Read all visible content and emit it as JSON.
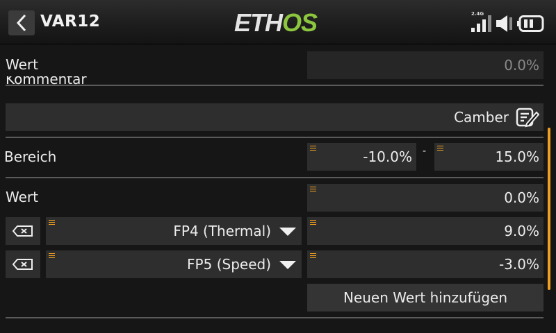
{
  "header": {
    "title": "VAR12",
    "logo_part1": "ETH",
    "logo_part2": "OS",
    "rf_label": "2.4G"
  },
  "value_row": {
    "label": "Wert",
    "value": "0.0%"
  },
  "comment_row": {
    "label": "Kommentar",
    "value": "Camber"
  },
  "range_row": {
    "label": "Bereich",
    "min": "-10.0%",
    "separator": "-",
    "max": "15.0%"
  },
  "values_section": {
    "label": "Wert",
    "default_value": "0.0%",
    "entries": [
      {
        "flight_mode": "FP4 (Thermal)",
        "value": "9.0%"
      },
      {
        "flight_mode": "FP5 (Speed)",
        "value": "-3.0%"
      }
    ],
    "add_button": "Neuen Wert hinzufügen"
  },
  "colors": {
    "accent": "#f0a020",
    "logo_green": "#8cc63f",
    "background": "#161616",
    "field": "#2e2e2e"
  },
  "icons": [
    "back-chevron-icon",
    "signal-bars-icon",
    "speaker-icon",
    "battery-icon",
    "edit-icon",
    "delete-icon",
    "dropdown-caret-icon"
  ]
}
